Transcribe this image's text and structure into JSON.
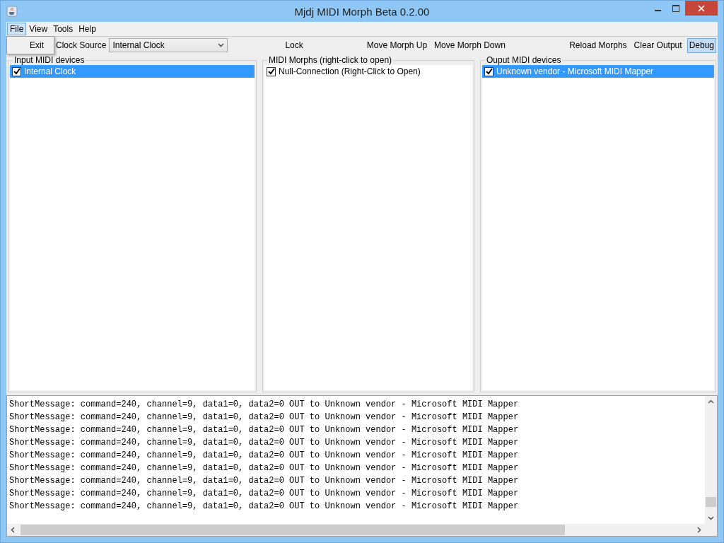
{
  "window": {
    "title": "Mjdj MIDI Morph Beta 0.2.00"
  },
  "menu": [
    {
      "label": "File",
      "selected": true
    },
    {
      "label": "View",
      "selected": false
    },
    {
      "label": "Tools",
      "selected": false
    },
    {
      "label": "Help",
      "selected": false
    }
  ],
  "open_menu": {
    "items": [
      "Exit"
    ]
  },
  "toolbar": {
    "clock_label": "Clock Source",
    "clock_value": "Internal Clock",
    "lock": "Lock",
    "move_buttons": [
      "Move Morph Up",
      "Move Morph Down"
    ],
    "right_buttons": [
      {
        "label": "Reload Morphs",
        "pressed": false
      },
      {
        "label": "Clear Output",
        "pressed": false
      },
      {
        "label": "Debug",
        "pressed": true
      }
    ]
  },
  "panels": [
    {
      "title": "Input MIDI devices",
      "items": [
        {
          "label": "Internal Clock",
          "checked": true,
          "selected": true
        }
      ]
    },
    {
      "title": "MIDI Morphs (right-click to open)",
      "items": [
        {
          "label": "Null-Connection (Right-Click to Open)",
          "checked": true,
          "selected": false
        }
      ]
    },
    {
      "title": "Ouput MIDI devices",
      "items": [
        {
          "label": "Unknown vendor - Microsoft MIDI Mapper",
          "checked": true,
          "selected": true
        }
      ]
    }
  ],
  "output": {
    "lines": [
      "ShortMessage: command=240, channel=9, data1=0, data2=0 OUT to Unknown vendor - Microsoft MIDI Mapper",
      "ShortMessage: command=240, channel=9, data1=0, data2=0 OUT to Unknown vendor - Microsoft MIDI Mapper",
      "ShortMessage: command=240, channel=9, data1=0, data2=0 OUT to Unknown vendor - Microsoft MIDI Mapper",
      "ShortMessage: command=240, channel=9, data1=0, data2=0 OUT to Unknown vendor - Microsoft MIDI Mapper",
      "ShortMessage: command=240, channel=9, data1=0, data2=0 OUT to Unknown vendor - Microsoft MIDI Mapper",
      "ShortMessage: command=240, channel=9, data1=0, data2=0 OUT to Unknown vendor - Microsoft MIDI Mapper",
      "ShortMessage: command=240, channel=9, data1=0, data2=0 OUT to Unknown vendor - Microsoft MIDI Mapper",
      "ShortMessage: command=240, channel=9, data1=0, data2=0 OUT to Unknown vendor - Microsoft MIDI Mapper",
      "ShortMessage: command=240, channel=9, data1=0, data2=0 OUT to Unknown vendor - Microsoft MIDI Mapper"
    ]
  }
}
